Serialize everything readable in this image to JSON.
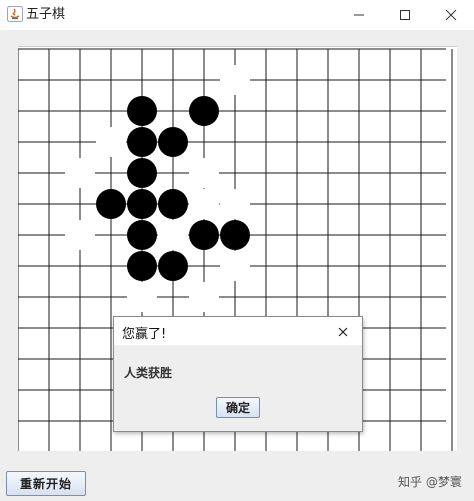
{
  "window": {
    "title": "五子棋"
  },
  "board": {
    "black_stones": [
      [
        4,
        2
      ],
      [
        6,
        2
      ],
      [
        4,
        3
      ],
      [
        5,
        3
      ],
      [
        4,
        4
      ],
      [
        3,
        5
      ],
      [
        4,
        5
      ],
      [
        5,
        5
      ],
      [
        4,
        6
      ],
      [
        6,
        6
      ],
      [
        7,
        6
      ],
      [
        4,
        7
      ],
      [
        5,
        7
      ]
    ],
    "white_stones": [
      [
        7,
        1
      ],
      [
        3,
        3
      ],
      [
        2,
        4
      ],
      [
        6,
        4
      ],
      [
        6,
        5
      ],
      [
        7,
        5
      ],
      [
        2,
        6
      ],
      [
        5,
        6
      ],
      [
        7,
        7
      ],
      [
        4,
        8
      ],
      [
        6,
        8
      ]
    ]
  },
  "dialog": {
    "title": "您赢了!",
    "message": "人类获胜",
    "ok_label": "确定"
  },
  "controls": {
    "restart_label": "重新开始"
  },
  "watermark": "知乎 @梦寰"
}
